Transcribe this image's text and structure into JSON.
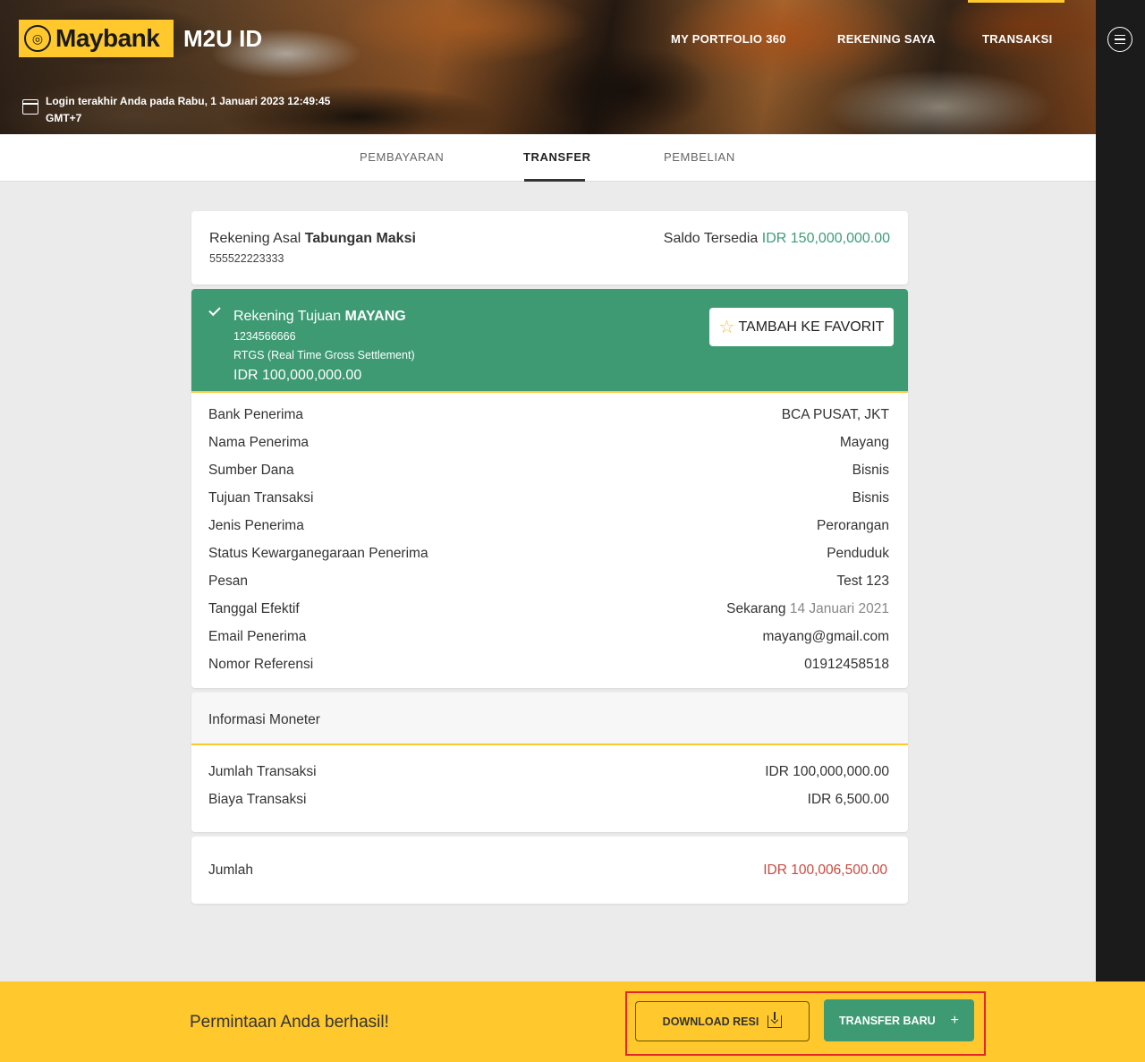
{
  "header": {
    "logo_text": "Maybank",
    "app_name": "M2U ID",
    "nav": [
      "MY PORTFOLIO 360",
      "REKENING SAYA",
      "TRANSAKSI"
    ],
    "login_line1": "Login terakhir Anda pada Rabu, 1 Januari 2023 12:49:45",
    "login_line2": "GMT+7"
  },
  "tabs": [
    "PEMBAYARAN",
    "TRANSFER",
    "PEMBELIAN"
  ],
  "source": {
    "label": "Rekening Asal",
    "name": "Tabungan Maksi",
    "number": "555522223333",
    "balance_label": "Saldo Tersedia",
    "balance": "IDR 150,000,000.00"
  },
  "destination": {
    "label": "Rekening Tujuan",
    "name": "MAYANG",
    "number": "1234566666",
    "method": "RTGS (Real Time Gross Settlement)",
    "amount": "IDR 100,000,000.00",
    "favorite_label": "TAMBAH KE FAVORIT"
  },
  "details": [
    {
      "label": "Bank Penerima",
      "value": "BCA PUSAT, JKT"
    },
    {
      "label": "Nama Penerima",
      "value": "Mayang"
    },
    {
      "label": "Sumber Dana",
      "value": "Bisnis"
    },
    {
      "label": "Tujuan Transaksi",
      "value": "Bisnis"
    },
    {
      "label": "Jenis Penerima",
      "value": "Perorangan"
    },
    {
      "label": "Status Kewarganegaraan Penerima",
      "value": "Penduduk"
    },
    {
      "label": "Pesan",
      "value": "Test 123"
    },
    {
      "label": "Tanggal Efektif",
      "value": "Sekarang",
      "value_sub": "14 Januari 2021"
    },
    {
      "label": "Email Penerima",
      "value": "mayang@gmail.com"
    },
    {
      "label": "Nomor Referensi",
      "value": "01912458518"
    }
  ],
  "monetary": {
    "title": "Informasi Moneter",
    "rows": [
      {
        "label": "Jumlah Transaksi",
        "value": "IDR 100,000,000.00"
      },
      {
        "label": "Biaya Transaksi",
        "value": "IDR 6,500.00"
      }
    ]
  },
  "total": {
    "label": "Jumlah",
    "value": "IDR 100,006,500.00"
  },
  "footer": {
    "message": "Permintaan Anda berhasil!",
    "download_label": "DOWNLOAD RESI",
    "new_transfer_label": "TRANSFER BARU"
  },
  "colors": {
    "brand_yellow": "#ffc82c",
    "success_green": "#3d9a73",
    "total_red": "#c94a3f",
    "highlight_red": "#e3262a"
  }
}
